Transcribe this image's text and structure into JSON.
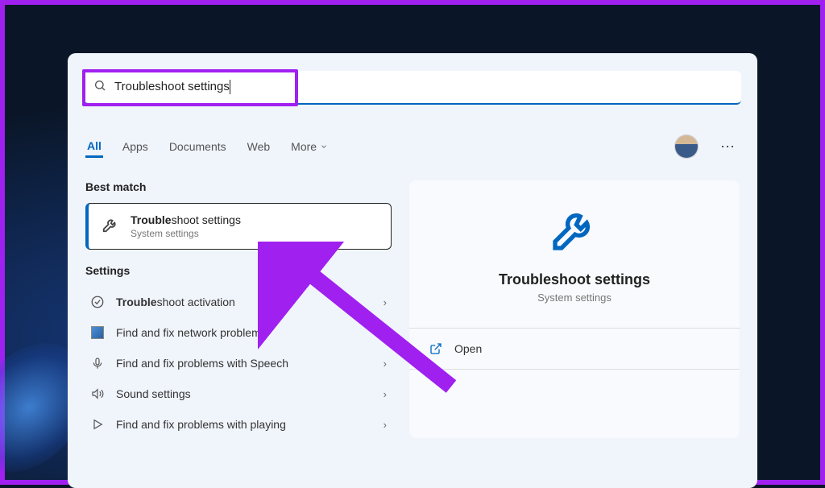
{
  "search": {
    "value": "Troubleshoot settings"
  },
  "tabs": {
    "all": "All",
    "apps": "Apps",
    "documents": "Documents",
    "web": "Web",
    "more": "More"
  },
  "sections": {
    "best_match": "Best match",
    "settings": "Settings"
  },
  "best_match": {
    "title_prefix": "Trouble",
    "title_suffix": "shoot settings",
    "subtitle": "System settings"
  },
  "settings_items": [
    {
      "prefix": "Trouble",
      "suffix": "shoot activation"
    },
    {
      "prefix": "",
      "suffix": "Find and fix network problems"
    },
    {
      "prefix": "",
      "suffix": "Find and fix problems with Speech"
    },
    {
      "prefix": "",
      "suffix": "Sound settings"
    },
    {
      "prefix": "",
      "suffix": "Find and fix problems with playing"
    }
  ],
  "detail": {
    "title": "Troubleshoot settings",
    "subtitle": "System settings",
    "action_open": "Open"
  }
}
